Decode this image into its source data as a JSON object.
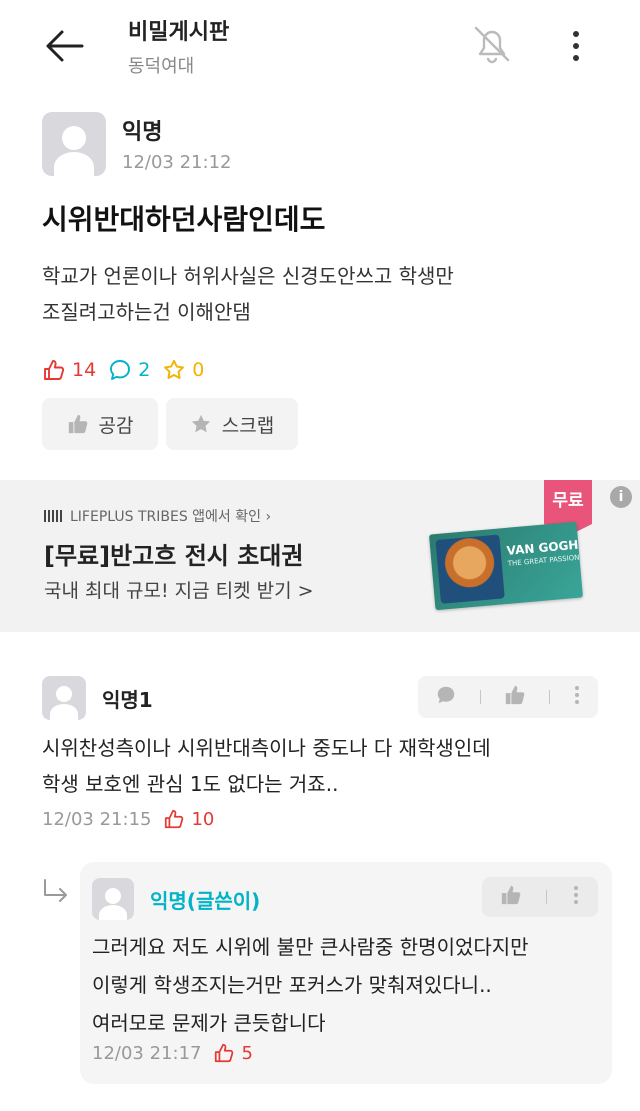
{
  "header": {
    "title": "비밀게시판",
    "subtitle": "동덕여대",
    "back_icon": "arrow-left-icon",
    "bell_icon": "bell-off-icon",
    "more_icon": "more-vertical-icon"
  },
  "post": {
    "author": "익명",
    "time": "12/03 21:12",
    "title": "시위반대하던사람인데도",
    "body_lines": [
      "학교가 언론이나 허위사실은 신경도안쓰고 학생만",
      "조질려고하는건 이해안댐"
    ],
    "likes": "14",
    "comments": "2",
    "scraps": "0",
    "like_button": "공감",
    "scrap_button": "스크랩"
  },
  "ad": {
    "source": "LIFEPLUS TRIBES 앱에서 확인 ›",
    "headline": "[무료]반고흐 전시 초대권",
    "subline": "국내 최대 규모! 지금 티켓 받기 >",
    "badge": "무료",
    "info": "i",
    "image_title": "VAN GOGH",
    "image_subtitle": "THE GREAT PASSION"
  },
  "comments": [
    {
      "author": "익명1",
      "body_lines": [
        "시위찬성측이나 시위반대측이나 중도나 다 재학생인데",
        "학생 보호엔 관심 1도 없다는 거죠.."
      ],
      "time": "12/03 21:15",
      "likes": "10",
      "reply": {
        "author": "익명(글쓴이)",
        "body_lines": [
          "그러게요 저도 시위에 불만 큰사람중 한명이었다지만",
          "이렇게 학생조지는거만 포커스가 맞춰져있다니..",
          "여러모로 문제가 큰듯합니다"
        ],
        "time": "12/03 21:17",
        "likes": "5"
      }
    }
  ],
  "colors": {
    "like_red": "#e53935",
    "comment_cyan": "#00b3c7",
    "scrap_yellow": "#f1b400",
    "badge_pink": "#e8547a"
  }
}
